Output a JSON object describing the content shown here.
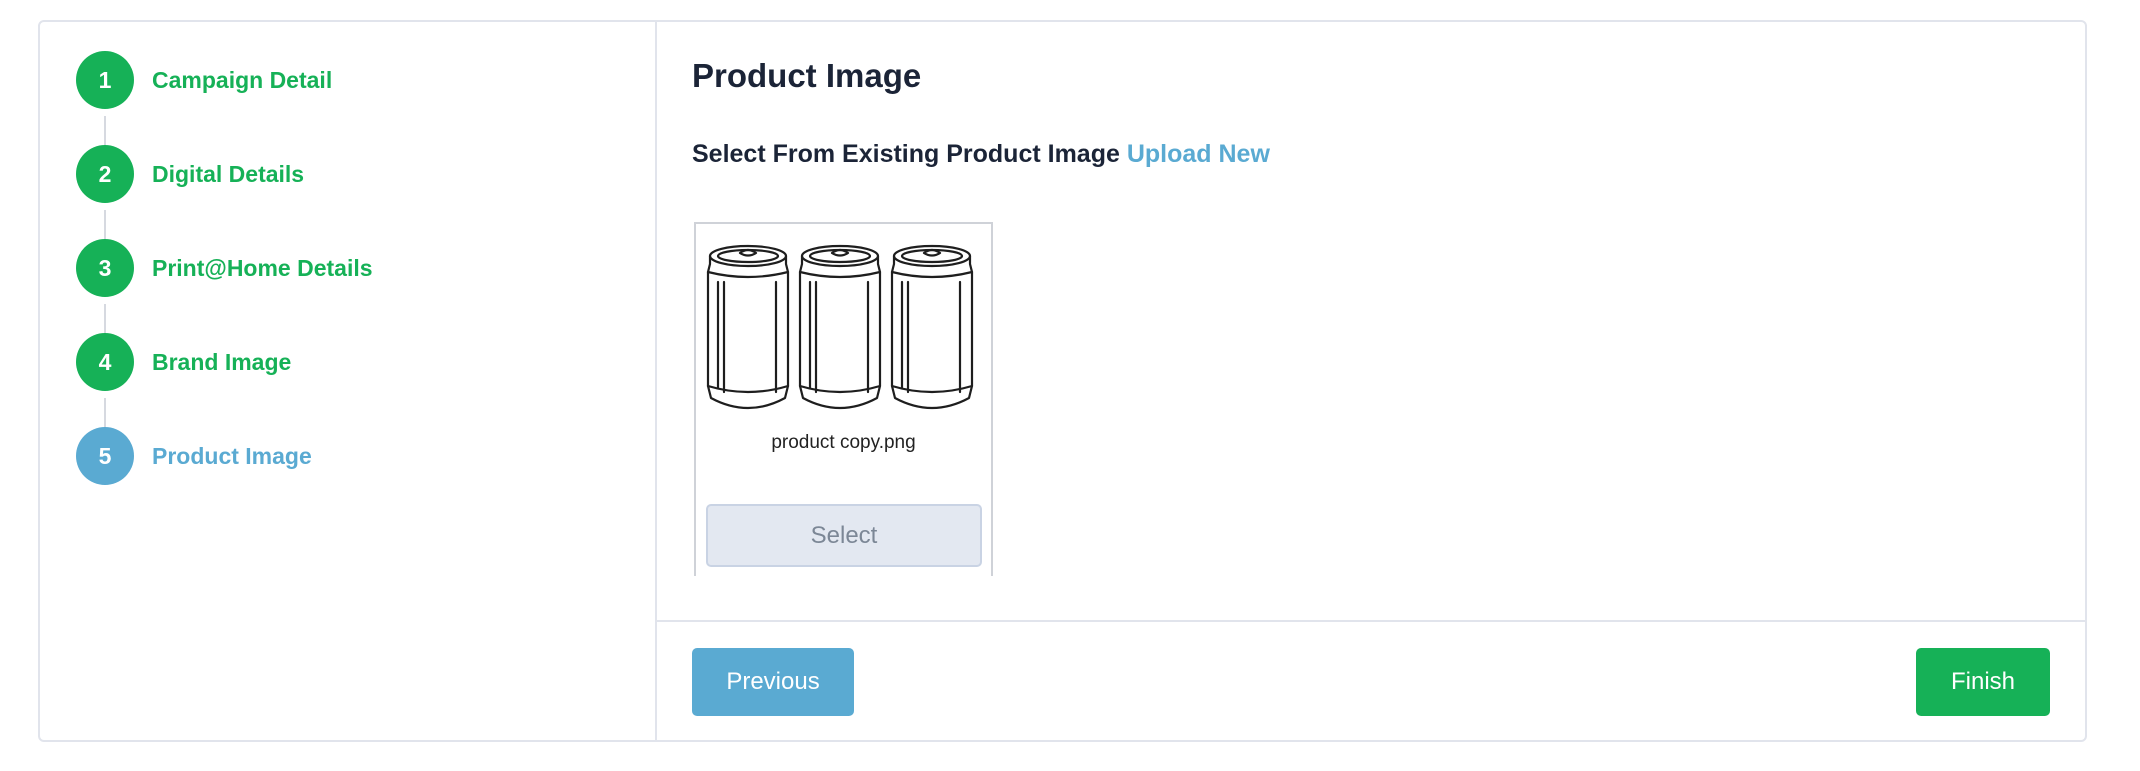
{
  "steps": [
    {
      "number": "1",
      "label": "Campaign Detail",
      "state": "done"
    },
    {
      "number": "2",
      "label": "Digital Details",
      "state": "done"
    },
    {
      "number": "3",
      "label": "Print@Home Details",
      "state": "done"
    },
    {
      "number": "4",
      "label": "Brand Image",
      "state": "done"
    },
    {
      "number": "5",
      "label": "Product Image",
      "state": "active"
    }
  ],
  "main": {
    "title": "Product Image",
    "subtitle_prefix": "Select From Existing Product Image",
    "upload_link": "Upload New",
    "images": [
      {
        "file_name": "product copy.png",
        "icon": "soda-cans-icon",
        "select_label": "Select"
      }
    ]
  },
  "footer": {
    "previous_label": "Previous",
    "finish_label": "Finish"
  },
  "colors": {
    "done": "#16b157",
    "active": "#5aaad2",
    "title": "#1b2437"
  }
}
